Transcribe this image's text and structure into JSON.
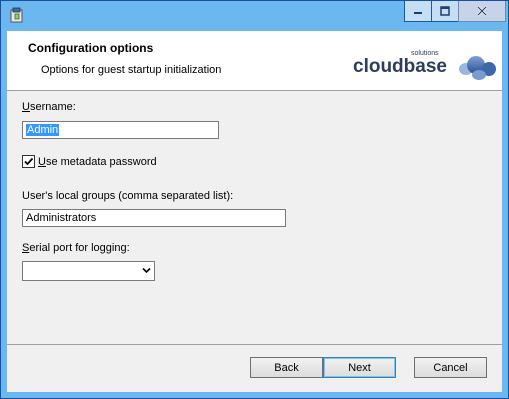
{
  "window": {
    "title": ""
  },
  "header": {
    "title": "Configuration options",
    "subtitle": "Options for guest startup initialization",
    "logo_text": "cloudbase",
    "logo_sub": "solutions"
  },
  "form": {
    "username_label_u": "U",
    "username_label_rest": "sername:",
    "username_value": "Admin",
    "metadata_checkbox": {
      "prefix": "U",
      "rest": "se metadata password",
      "checked": true
    },
    "groups_label_pre": "User's local ",
    "groups_label_u": "g",
    "groups_label_rest": "roups (comma separated list):",
    "groups_value": "Administrators",
    "serial_label_u": "S",
    "serial_label_rest": "erial port for logging:",
    "serial_value": ""
  },
  "buttons": {
    "back": "Back",
    "next": "Next",
    "cancel": "Cancel"
  }
}
